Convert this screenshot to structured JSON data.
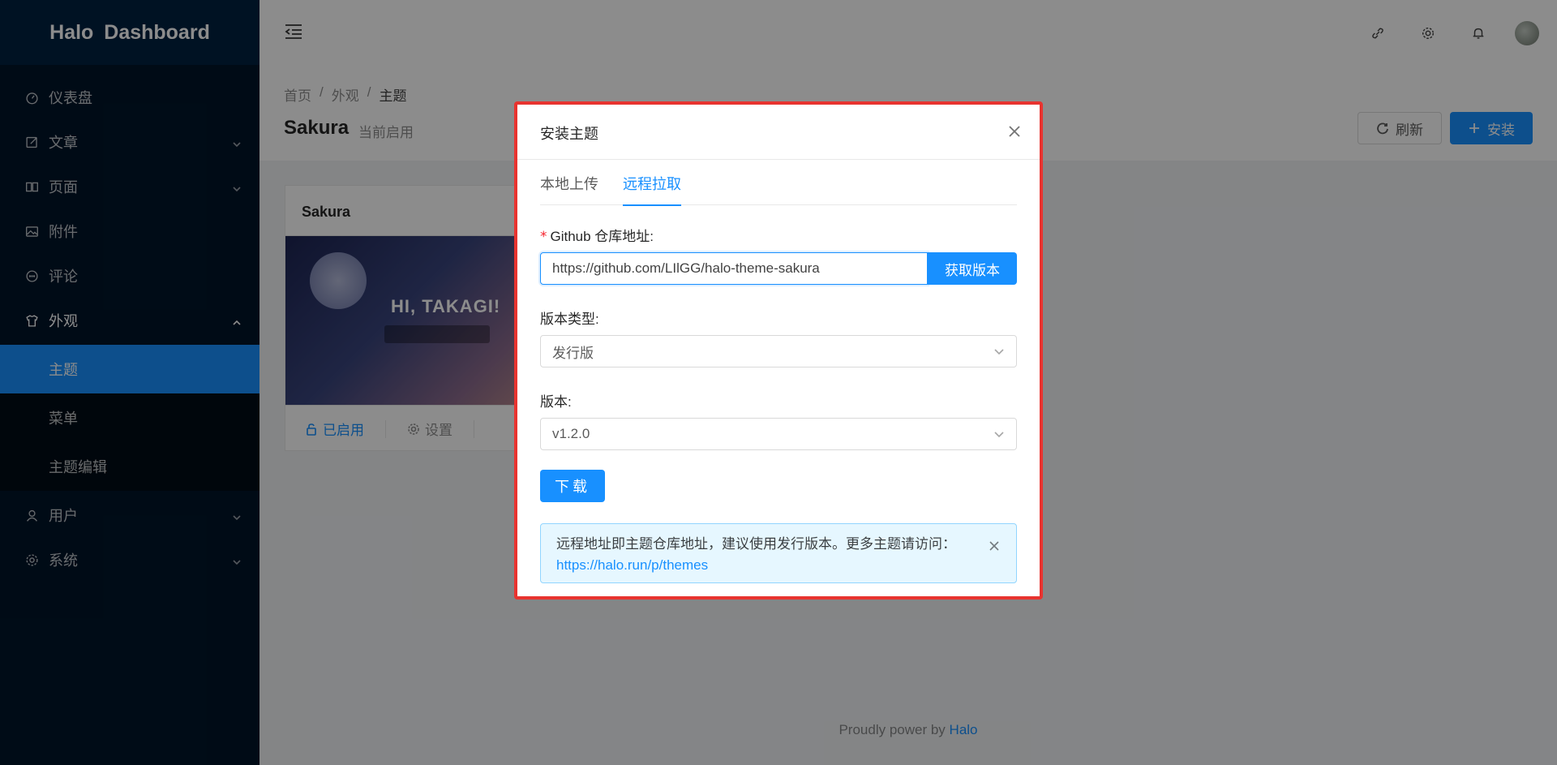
{
  "app": {
    "title": "Halo Dashboard"
  },
  "sidebar": {
    "items": [
      {
        "label": "仪表盘",
        "icon": "dashboard-icon"
      },
      {
        "label": "文章",
        "icon": "edit-icon"
      },
      {
        "label": "页面",
        "icon": "read-icon"
      },
      {
        "label": "附件",
        "icon": "picture-icon"
      },
      {
        "label": "评论",
        "icon": "message-icon"
      },
      {
        "label": "外观",
        "icon": "skin-icon"
      },
      {
        "label": "用户",
        "icon": "user-icon"
      },
      {
        "label": "系统",
        "icon": "setting-icon"
      }
    ],
    "appearance_sub": [
      {
        "label": "主题"
      },
      {
        "label": "菜单"
      },
      {
        "label": "主题编辑"
      }
    ]
  },
  "header": {
    "icons": [
      "link-icon",
      "gear-icon",
      "bell-icon",
      "avatar"
    ]
  },
  "page": {
    "breadcrumb": [
      "首页",
      "外观",
      "主题"
    ],
    "title": "Sakura",
    "subtitle": "当前启用",
    "refresh_label": "刷新",
    "install_label": "安装"
  },
  "card": {
    "title": "Sakura",
    "cover_text": "HI, TAKAGI!",
    "enabled_label": "已启用",
    "settings_label": "设置"
  },
  "footer": {
    "text": "Proudly power by ",
    "link": "Halo"
  },
  "modal": {
    "title": "安装主题",
    "tabs": [
      "本地上传",
      "远程拉取"
    ],
    "active_tab": "远程拉取",
    "repo_label": "Github 仓库地址:",
    "repo_value": "https://github.com/LIlGG/halo-theme-sakura",
    "fetch_label": "获取版本",
    "type_label": "版本类型:",
    "type_value": "发行版",
    "version_label": "版本:",
    "version_value": "v1.2.0",
    "download_label": "下载",
    "alert_text": "远程地址即主题仓库地址，建议使用发行版本。更多主题请访问：",
    "alert_link": "https://halo.run/p/themes"
  },
  "colors": {
    "primary": "#1890ff",
    "sidebar_bg": "#001529",
    "highlight_border": "#e8332f"
  }
}
